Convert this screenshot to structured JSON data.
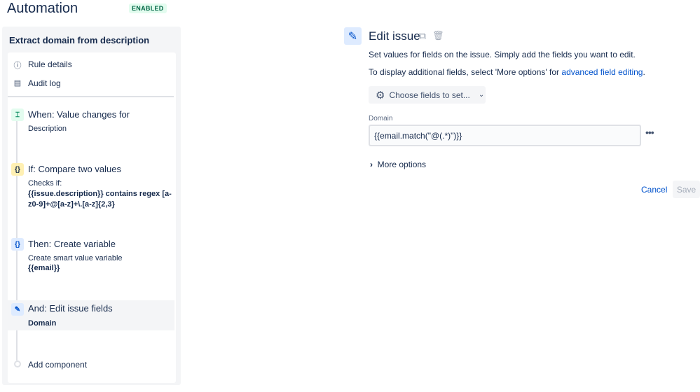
{
  "header": {
    "title": "Automation",
    "status": "ENABLED"
  },
  "rule": {
    "name": "Extract domain from description",
    "nav": [
      {
        "label": "Rule details",
        "icon": "info-icon"
      },
      {
        "label": "Audit log",
        "icon": "document-icon"
      }
    ],
    "components": [
      {
        "heading": "When: Value changes for",
        "lines": [
          "Description"
        ],
        "icon": "trigger-icon"
      },
      {
        "heading": "If: Compare two values",
        "lines": [
          "Checks if:",
          "{{issue.description}} contains regex [a-z0-9]+@[a-z]+\\.[a-z]{2,3}"
        ],
        "icon": "braces-icon"
      },
      {
        "heading": "Then: Create variable",
        "lines": [
          "Create smart value variable",
          "{{email}}"
        ],
        "icon": "braces-icon"
      },
      {
        "heading": "And: Edit issue fields",
        "lines": [
          "Domain"
        ],
        "icon": "pencil-icon"
      }
    ],
    "add_component": "Add component"
  },
  "editor": {
    "title": "Edit issue",
    "desc1": "Set values for fields on the issue. Simply add the fields you want to edit.",
    "desc2_prefix": "To display additional fields, select 'More options' for ",
    "desc2_link": "advanced field editing",
    "desc2_suffix": ".",
    "choose_fields": "Choose fields to set...",
    "field_label": "Domain",
    "field_value": "{{email.match(\"@(.*)\")}}",
    "more_options": "More options",
    "cancel": "Cancel",
    "save": "Save"
  },
  "colors": {
    "accent": "#0052cc",
    "enabled_bg": "#e3fcef",
    "enabled_text": "#006644"
  }
}
